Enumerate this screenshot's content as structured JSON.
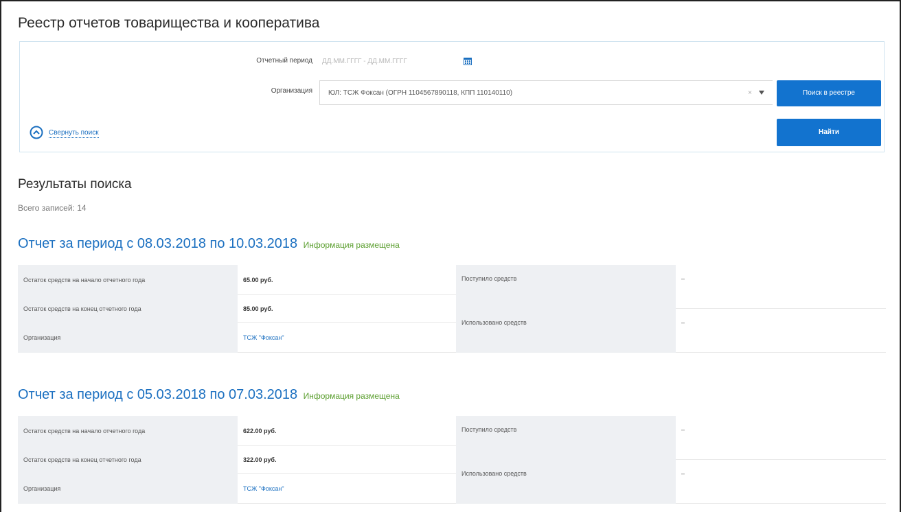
{
  "page": {
    "title": "Реестр отчетов товарищества и кооператива"
  },
  "filters": {
    "period_label": "Отчетный период",
    "period_placeholder": "ДД.ММ.ГГГГ - ДД.ММ.ГГГГ",
    "org_label": "Организация",
    "org_value": "ЮЛ: ТСЖ Фоксан (ОГРН 1104567890118, КПП 110140110)",
    "clear_symbol": "×",
    "registry_button": "Поиск в реестре",
    "find_button": "Найти",
    "collapse_label": "Свернуть поиск"
  },
  "results": {
    "title": "Результаты поиска",
    "total": "Всего записей: 14"
  },
  "reports": [
    {
      "title": "Отчет за период с 08.03.2018 по 10.03.2018",
      "status": "Информация размещена",
      "rows": [
        {
          "label": "Остаток средств на начало отчетного года",
          "value": "65.00 руб."
        },
        {
          "label": "Остаток средств на конец отчетного года",
          "value": "85.00 руб."
        },
        {
          "label": "Организация",
          "value": "ТСЖ \"Фоксан\""
        }
      ],
      "right": [
        {
          "label": "Поступило средств",
          "value": "–"
        },
        {
          "label": "Использовано средств",
          "value": "–"
        }
      ]
    },
    {
      "title": "Отчет за период с 05.03.2018 по 07.03.2018",
      "status": "Информация размещена",
      "rows": [
        {
          "label": "Остаток средств на начало отчетного года",
          "value": "622.00 руб."
        },
        {
          "label": "Остаток средств на конец отчетного года",
          "value": "322.00 руб."
        },
        {
          "label": "Организация",
          "value": "ТСЖ \"Фоксан\""
        }
      ],
      "right": [
        {
          "label": "Поступило средств",
          "value": "–"
        },
        {
          "label": "Использовано средств",
          "value": "–"
        }
      ]
    }
  ],
  "colors": {
    "accent": "#1273cf",
    "link": "#1a6fc0",
    "status": "#5a9e2e",
    "label_bg": "#eef0f3"
  }
}
